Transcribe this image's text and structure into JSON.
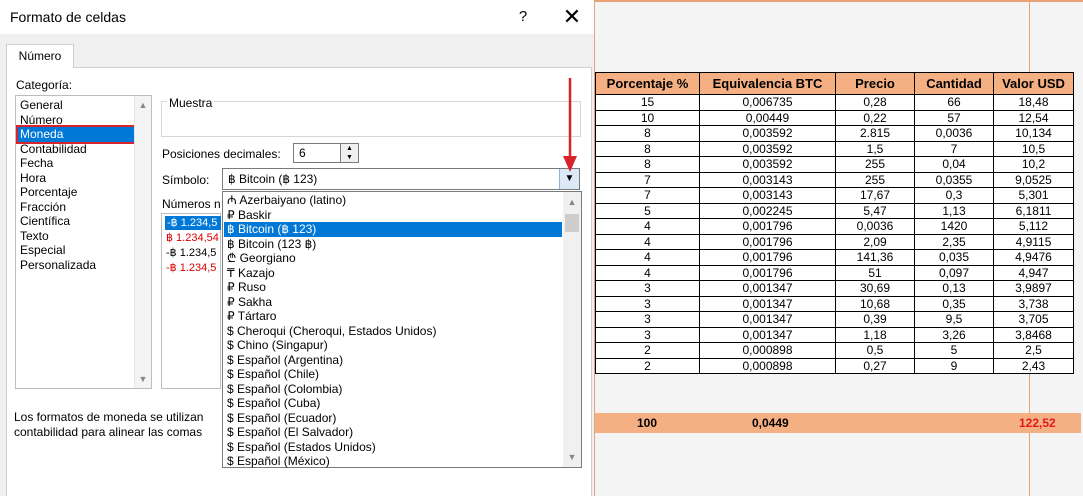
{
  "dialog": {
    "title": "Formato de celdas",
    "help": "?",
    "close": "✕",
    "tab": "Número",
    "category_label": "Categoría:",
    "categories": [
      "General",
      "Número",
      "Moneda",
      "Contabilidad",
      "Fecha",
      "Hora",
      "Porcentaje",
      "Fracción",
      "Científica",
      "Texto",
      "Especial",
      "Personalizada"
    ],
    "selected_category": "Moneda",
    "sample_label": "Muestra",
    "decimals_label": "Posiciones decimales:",
    "decimals_value": "6",
    "symbol_label": "Símbolo:",
    "symbol_value": "฿ Bitcoin (฿ 123)",
    "negative_label": "Números n",
    "negative_items": [
      "-฿ 1.234,5",
      "฿ 1.234,54",
      "-฿ 1.234,5",
      "-฿ 1.234,5"
    ],
    "symbol_options": [
      "₼ Azerbaiyano (latino)",
      "₽ Baskir",
      "฿ Bitcoin (฿ 123)",
      "฿ Bitcoin (123 ฿)",
      "₾ Georgiano",
      "₸ Kazajo",
      "₽ Ruso",
      "₽ Sakha",
      "₽ Tártaro",
      "$ Cheroqui (Cheroqui, Estados Unidos)",
      "$ Chino (Singapur)",
      "$ Español (Argentina)",
      "$ Español (Chile)",
      "$ Español (Colombia)",
      "$ Español (Cuba)",
      "$ Español (Ecuador)",
      "$ Español (El Salvador)",
      "$ Español (Estados Unidos)",
      "$ Español (México)"
    ],
    "footer_line1": "Los formatos de moneda se utilizan",
    "footer_line2": "contabilidad para alinear las comas"
  },
  "sheet": {
    "headers": [
      "Porcentaje %",
      "Equivalencia BTC",
      "Precio",
      "Cantidad",
      "Valor USD"
    ],
    "rows": [
      [
        "15",
        "0,006735",
        "0,28",
        "66",
        "18,48"
      ],
      [
        "10",
        "0,00449",
        "0,22",
        "57",
        "12,54"
      ],
      [
        "8",
        "0,003592",
        "2.815",
        "0,0036",
        "10,134"
      ],
      [
        "8",
        "0,003592",
        "1,5",
        "7",
        "10,5"
      ],
      [
        "8",
        "0,003592",
        "255",
        "0,04",
        "10,2"
      ],
      [
        "7",
        "0,003143",
        "255",
        "0,0355",
        "9,0525"
      ],
      [
        "7",
        "0,003143",
        "17,67",
        "0,3",
        "5,301"
      ],
      [
        "5",
        "0,002245",
        "5,47",
        "1,13",
        "6,1811"
      ],
      [
        "4",
        "0,001796",
        "0,0036",
        "1420",
        "5,112"
      ],
      [
        "4",
        "0,001796",
        "2,09",
        "2,35",
        "4,9115"
      ],
      [
        "4",
        "0,001796",
        "141,36",
        "0,035",
        "4,9476"
      ],
      [
        "4",
        "0,001796",
        "51",
        "0,097",
        "4,947"
      ],
      [
        "3",
        "0,001347",
        "30,69",
        "0,13",
        "3,9897"
      ],
      [
        "3",
        "0,001347",
        "10,68",
        "0,35",
        "3,738"
      ],
      [
        "3",
        "0,001347",
        "0,39",
        "9,5",
        "3,705"
      ],
      [
        "3",
        "0,001347",
        "1,18",
        "3,26",
        "3,8468"
      ],
      [
        "2",
        "0,000898",
        "0,5",
        "5",
        "2,5"
      ],
      [
        "2",
        "0,000898",
        "0,27",
        "9",
        "2,43"
      ]
    ],
    "total_pct": "100",
    "total_btc": "0,0449",
    "total_usd": "122,52"
  },
  "colors": {
    "accent_blue": "#0078d7",
    "highlight_red": "#d8232a",
    "header_orange": "#f4b083"
  }
}
